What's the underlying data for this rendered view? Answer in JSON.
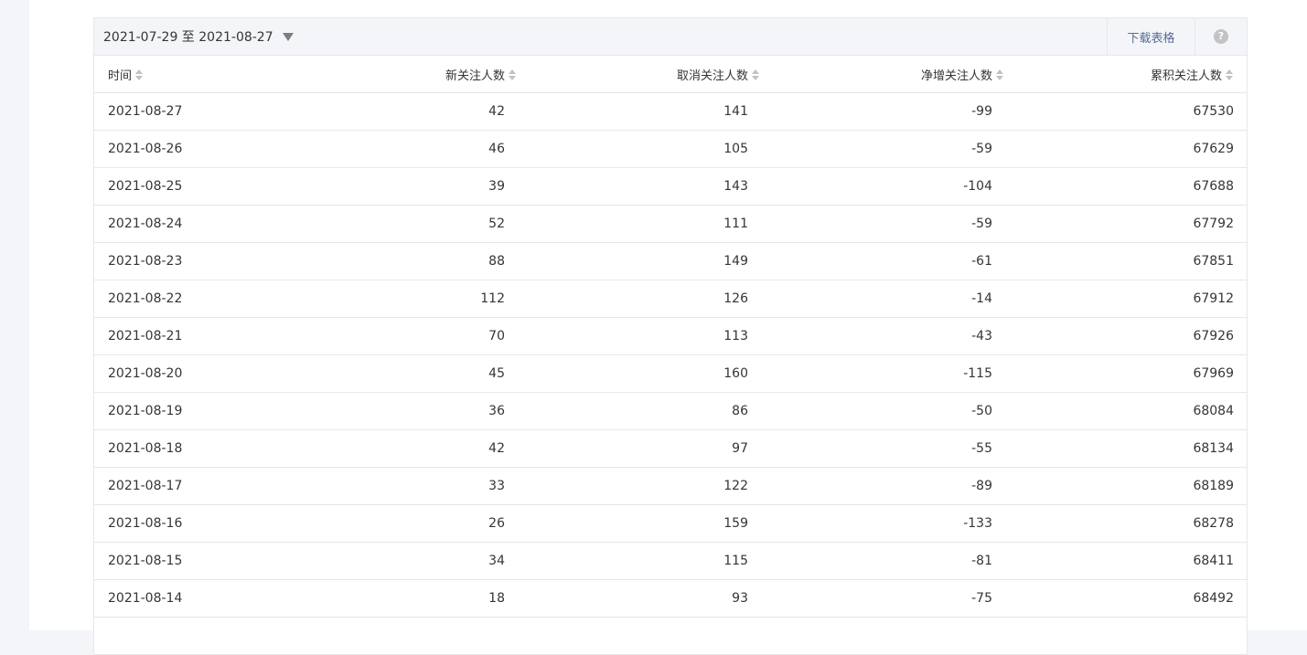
{
  "toolbar": {
    "date_range": "2021-07-29 至 2021-08-27",
    "download_label": "下载表格",
    "help_label": "?"
  },
  "table": {
    "columns": [
      "时间",
      "新关注人数",
      "取消关注人数",
      "净增关注人数",
      "累积关注人数"
    ],
    "rows": [
      [
        "2021-08-27",
        "42",
        "141",
        "-99",
        "67530"
      ],
      [
        "2021-08-26",
        "46",
        "105",
        "-59",
        "67629"
      ],
      [
        "2021-08-25",
        "39",
        "143",
        "-104",
        "67688"
      ],
      [
        "2021-08-24",
        "52",
        "111",
        "-59",
        "67792"
      ],
      [
        "2021-08-23",
        "88",
        "149",
        "-61",
        "67851"
      ],
      [
        "2021-08-22",
        "112",
        "126",
        "-14",
        "67912"
      ],
      [
        "2021-08-21",
        "70",
        "113",
        "-43",
        "67926"
      ],
      [
        "2021-08-20",
        "45",
        "160",
        "-115",
        "67969"
      ],
      [
        "2021-08-19",
        "36",
        "86",
        "-50",
        "68084"
      ],
      [
        "2021-08-18",
        "42",
        "97",
        "-55",
        "68134"
      ],
      [
        "2021-08-17",
        "33",
        "122",
        "-89",
        "68189"
      ],
      [
        "2021-08-16",
        "26",
        "159",
        "-133",
        "68278"
      ],
      [
        "2021-08-15",
        "34",
        "115",
        "-81",
        "68411"
      ],
      [
        "2021-08-14",
        "18",
        "93",
        "-75",
        "68492"
      ],
      [
        "",
        "",
        "",
        "",
        ""
      ]
    ]
  }
}
